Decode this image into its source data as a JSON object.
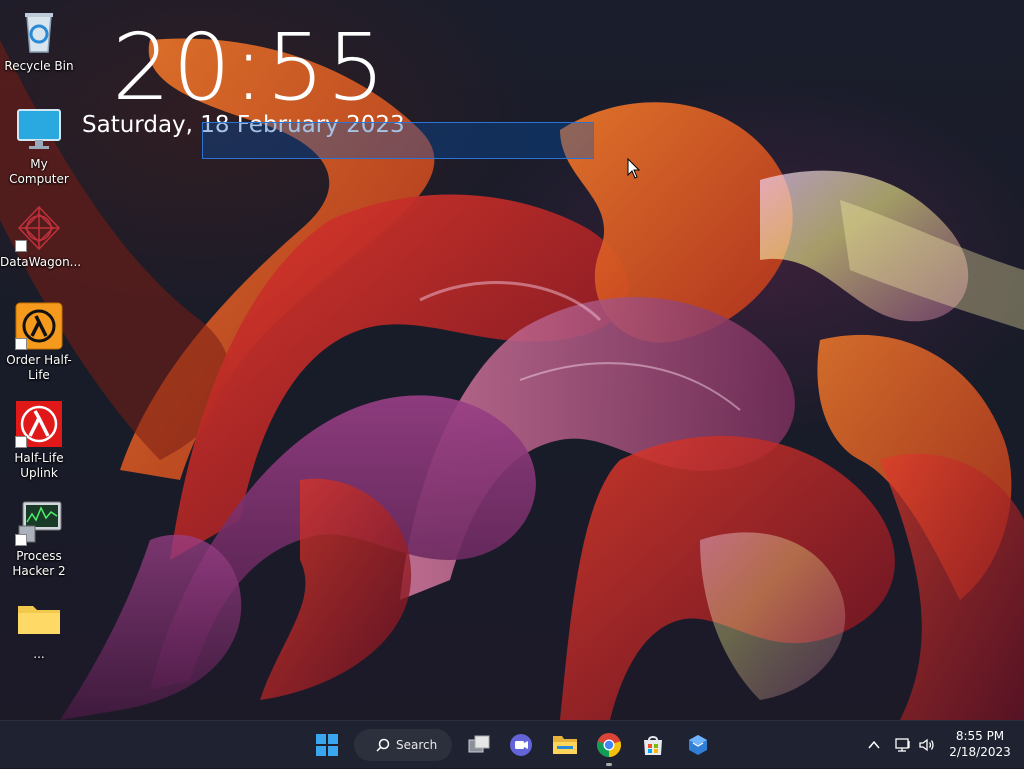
{
  "clock": {
    "time": "20:55",
    "date": "Saturday, 18 February 2023"
  },
  "desktop_icons": [
    {
      "label": "Recycle Bin",
      "icon": "recycle-bin-icon"
    },
    {
      "label": "My Computer",
      "icon": "monitor-icon"
    },
    {
      "label": "DataWagon...",
      "icon": "datawagon-icon"
    },
    {
      "label": "Order Half-Life",
      "icon": "half-life-lambda-icon"
    },
    {
      "label": "Half-Life Uplink",
      "icon": "half-life-uplink-icon"
    },
    {
      "label": "Process Hacker 2",
      "icon": "process-hacker-icon"
    },
    {
      "label": "...",
      "icon": "folder-icon"
    }
  ],
  "taskbar": {
    "search_label": "Search",
    "apps": [
      "start-icon",
      "task-view-icon",
      "chat-icon",
      "file-explorer-icon",
      "chrome-icon",
      "store-icon",
      "app-icon"
    ],
    "tray_time": "8:55 PM",
    "tray_date": "2/18/2023"
  },
  "colors": {
    "taskbar_bg": "#1f2230",
    "selection": "#2a74d6",
    "accent_orange": "#e8662a"
  }
}
